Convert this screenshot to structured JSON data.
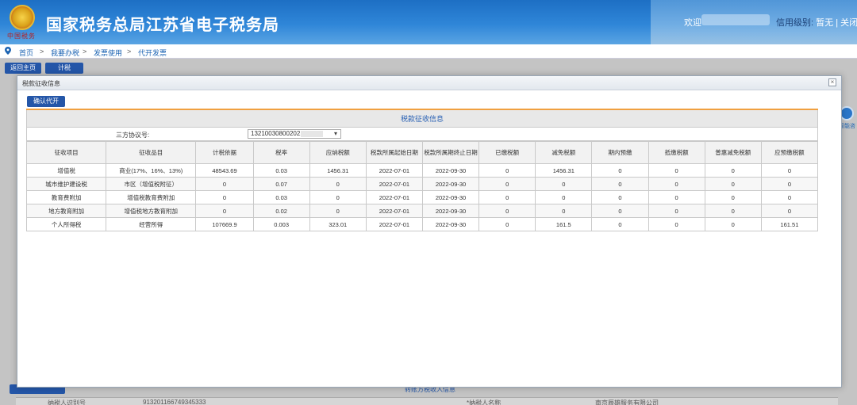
{
  "header": {
    "site_title": "国家税务总局江苏省电子税务局",
    "emblem_subtext": "中国税务",
    "welcome_label": "欢迎",
    "credit_label": "信用级别:",
    "credit_value": "暂无",
    "separator": "|",
    "close_label": "关闭当"
  },
  "breadcrumb": {
    "items": [
      "首页",
      "我要办税",
      "发票使用",
      "代开发票"
    ],
    "separator": ">"
  },
  "background": {
    "back_button": "返回主页",
    "tab_button": "计税",
    "help_label": "智能咨",
    "bottom_title": "转账方税收入信息",
    "bottom_row_left_label": "纳税人识别号",
    "bottom_row_left_value": "913201166749345333",
    "bottom_row_right_label": "*纳税人名称",
    "bottom_row_right_value": "南京辰雄服务有限公司"
  },
  "modal": {
    "title": "税款征收信息",
    "close_glyph": "×",
    "confirm_button": "确认代开",
    "section_title": "税款征收信息",
    "agreement_label": "三方协议号:",
    "agreement_value": "132100308002021",
    "agreement_chevron": "▾"
  },
  "table": {
    "columns": [
      "征收项目",
      "征收品目",
      "计税依据",
      "税率",
      "应纳税额",
      "税款所属起始日期",
      "税款所属期终止日期",
      "已缴税额",
      "减免税额",
      "期内预缴",
      "抵缴税额",
      "普惠减免税额",
      "应预缴税额"
    ],
    "rows": [
      [
        "增值税",
        "商业(17%、16%、13%)",
        "48543.69",
        "0.03",
        "1456.31",
        "2022-07-01",
        "2022-09-30",
        "0",
        "1456.31",
        "0",
        "0",
        "0",
        "0"
      ],
      [
        "城市维护建设税",
        "市区（增值税附征）",
        "0",
        "0.07",
        "0",
        "2022-07-01",
        "2022-09-30",
        "0",
        "0",
        "0",
        "0",
        "0",
        "0"
      ],
      [
        "教育费附加",
        "增值税教育费附加",
        "0",
        "0.03",
        "0",
        "2022-07-01",
        "2022-09-30",
        "0",
        "0",
        "0",
        "0",
        "0",
        "0"
      ],
      [
        "地方教育附加",
        "增值税地方教育附加",
        "0",
        "0.02",
        "0",
        "2022-07-01",
        "2022-09-30",
        "0",
        "0",
        "0",
        "0",
        "0",
        "0"
      ],
      [
        "个人所得税",
        "经营所得",
        "107669.9",
        "0.003",
        "323.01",
        "2022-07-01",
        "2022-09-30",
        "0",
        "161.5",
        "0",
        "0",
        "0",
        "161.51"
      ]
    ]
  },
  "colors": {
    "header_blue": "#1d6fc4",
    "button_blue": "#2456a8",
    "section_accent": "#f0a040",
    "link_blue": "#1d64b3"
  }
}
